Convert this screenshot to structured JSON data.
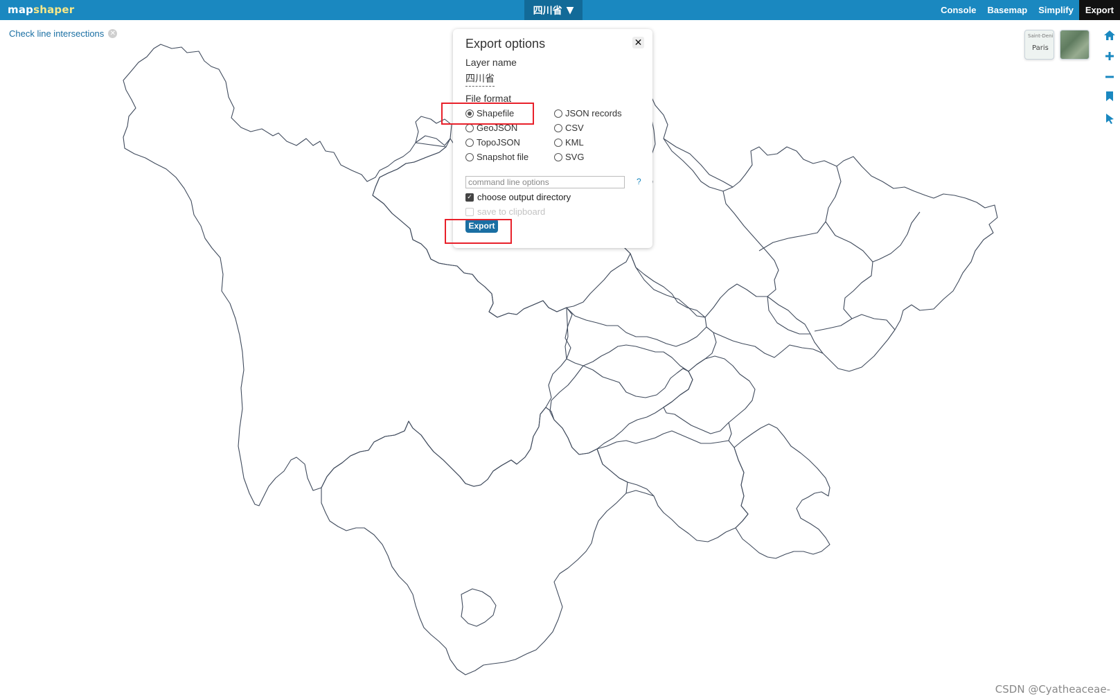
{
  "app": {
    "logo_a": "map",
    "logo_b": "shaper",
    "brand_color": "#1a88c0",
    "layer_select": "四川省",
    "layer_select_caret": "▼"
  },
  "nav": {
    "items": [
      "Console",
      "Basemap",
      "Simplify",
      "Export"
    ],
    "active": "Export"
  },
  "intersections": {
    "label": "Check line intersections",
    "close_glyph": "✕"
  },
  "basemaps": {
    "thumb1_top": "Saint-Deni",
    "thumb1_main": "Paris"
  },
  "tools": [
    "home-icon",
    "zoom-in-icon",
    "zoom-out-icon",
    "bookmark-icon",
    "pointer-icon"
  ],
  "dialog": {
    "title": "Export options",
    "close": "✕",
    "layer_name_label": "Layer name",
    "layer_name_value": "四川省",
    "file_format_label": "File format",
    "formats_left": [
      "Shapefile",
      "GeoJSON",
      "TopoJSON",
      "Snapshot file"
    ],
    "formats_right": [
      "JSON records",
      "CSV",
      "KML",
      "SVG"
    ],
    "selected_format": "Shapefile",
    "cmd_placeholder": "command line options",
    "help": "?",
    "choose_output_directory": "choose output directory",
    "choose_output_directory_checked": true,
    "save_to_clipboard": "save to clipboard",
    "save_to_clipboard_enabled": false,
    "export_button": "Export"
  },
  "annotation_color": "#e8202a",
  "watermark": "CSDN @Cyatheaceae-"
}
